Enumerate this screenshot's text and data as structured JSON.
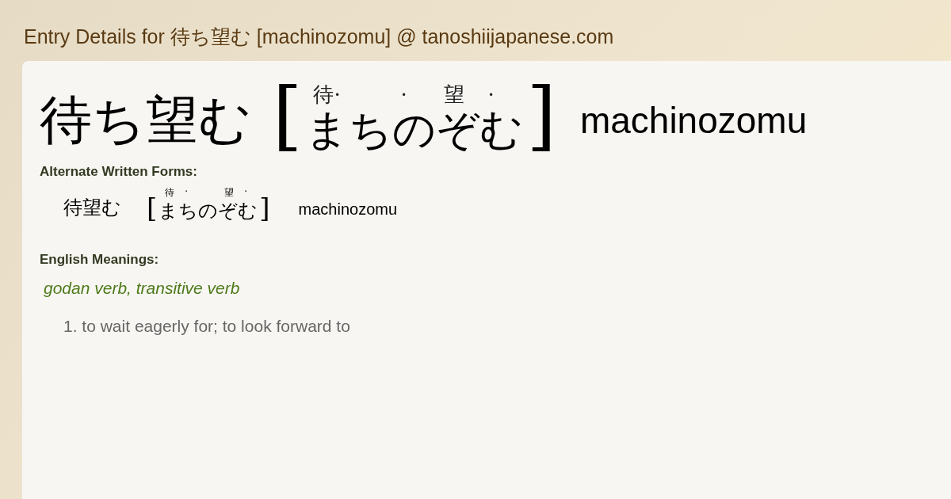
{
  "page_title": "Entry Details for 待ち望む [machinozomu] @ tanoshiijapanese.com",
  "entry": {
    "kanji": "待ち望む",
    "reading": [
      {
        "kana": "ま",
        "mark": "待·"
      },
      {
        "kana": "ち"
      },
      {
        "kana": "の",
        "mark": "·"
      },
      {
        "kana": "ぞ",
        "mark": "望"
      },
      {
        "kana": "む",
        "mark": "·"
      }
    ],
    "open_bracket": "[",
    "close_bracket": "]",
    "romaji": "machinozomu"
  },
  "alternate_heading": "Alternate Written Forms:",
  "alternates": [
    {
      "kanji": "待望む",
      "reading": [
        {
          "kana": "ま",
          "mark": "待"
        },
        {
          "kana": "ち",
          "mark": "·"
        },
        {
          "kana": "の"
        },
        {
          "kana": "ぞ",
          "mark": "望"
        },
        {
          "kana": "む",
          "mark": "·"
        }
      ],
      "open_bracket": "[",
      "close_bracket": "]",
      "romaji": "machinozomu"
    }
  ],
  "meanings_heading": "English Meanings:",
  "part_of_speech": "godan verb, transitive verb",
  "meanings": [
    "1. to wait eagerly for; to look forward to"
  ]
}
